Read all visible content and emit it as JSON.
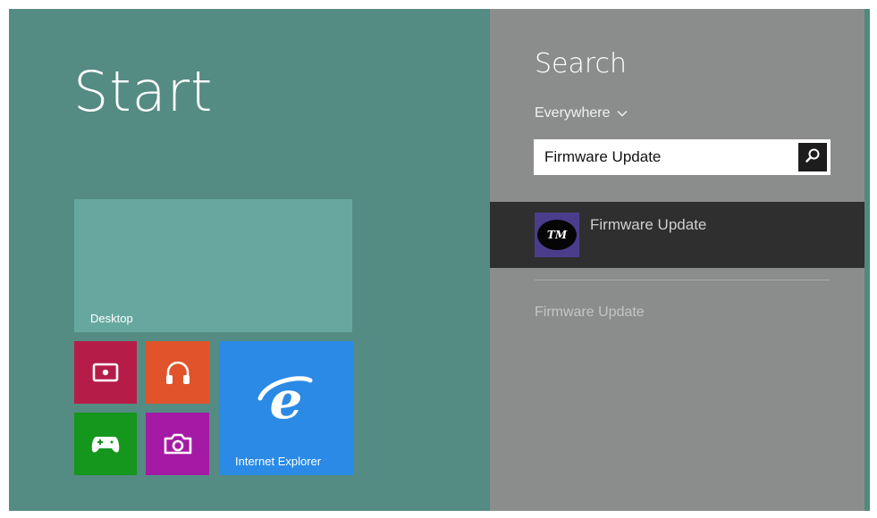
{
  "start": {
    "title": "Start",
    "tiles": {
      "desktop": {
        "label": "Desktop",
        "color": "#66a8a0"
      },
      "video": {
        "icon": "video-icon",
        "color": "#b51d48"
      },
      "music": {
        "icon": "headphones-icon",
        "color": "#e1532a"
      },
      "ie": {
        "label": "Internet Explorer",
        "icon": "internet-explorer-icon",
        "color": "#2a8ae6"
      },
      "games": {
        "icon": "xbox-controller-icon",
        "color": "#15961d"
      },
      "camera": {
        "icon": "camera-icon",
        "color": "#a51aa5"
      }
    }
  },
  "search": {
    "title": "Search",
    "scope": "Everywhere",
    "scope_icon": "chevron-down-icon",
    "query": "Firmware Update",
    "button_icon": "search-icon",
    "result": {
      "name": "Firmware Update",
      "icon_text": "TM",
      "icon_bg": "#4b3d8c"
    },
    "suggestion": "Firmware Update"
  },
  "colors": {
    "start_bg": "#548b82",
    "search_bg": "#8b8d8d",
    "result_bg": "#2f2f2f"
  }
}
